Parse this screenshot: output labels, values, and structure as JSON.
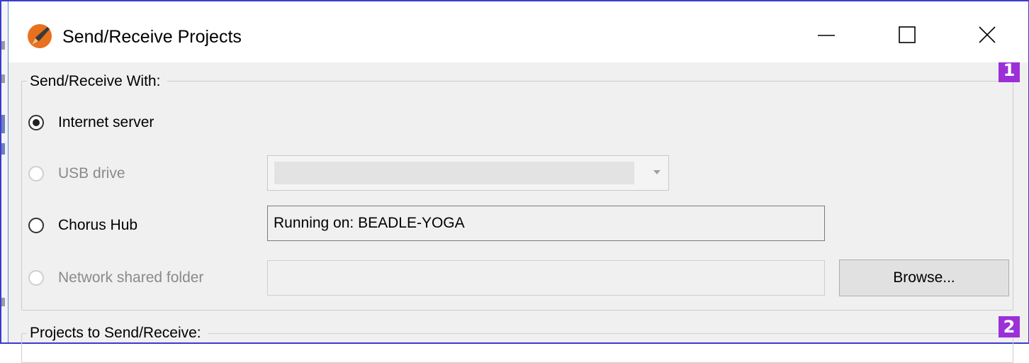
{
  "window": {
    "title": "Send/Receive Projects",
    "icon": "app-pen-icon"
  },
  "controls": {
    "minimize": "minimize-icon",
    "maximize": "maximize-icon",
    "close": "close-icon"
  },
  "send_receive_group": {
    "label": "Send/Receive With:",
    "badge": "1",
    "options": {
      "internet": {
        "label": "Internet server",
        "checked": true,
        "enabled": true
      },
      "usb": {
        "label": "USB drive",
        "checked": false,
        "enabled": false
      },
      "chorus": {
        "label": "Chorus Hub",
        "checked": false,
        "enabled": true,
        "status": "Running on: BEADLE-YOGA"
      },
      "network": {
        "label": "Network shared folder",
        "checked": false,
        "enabled": false,
        "path": ""
      }
    },
    "browse_label": "Browse..."
  },
  "projects_group": {
    "label": "Projects to Send/Receive:",
    "badge": "2"
  },
  "colors": {
    "accent_frame": "#3b3bd0",
    "badge": "#9b30d8",
    "icon_orange": "#e8711e"
  }
}
